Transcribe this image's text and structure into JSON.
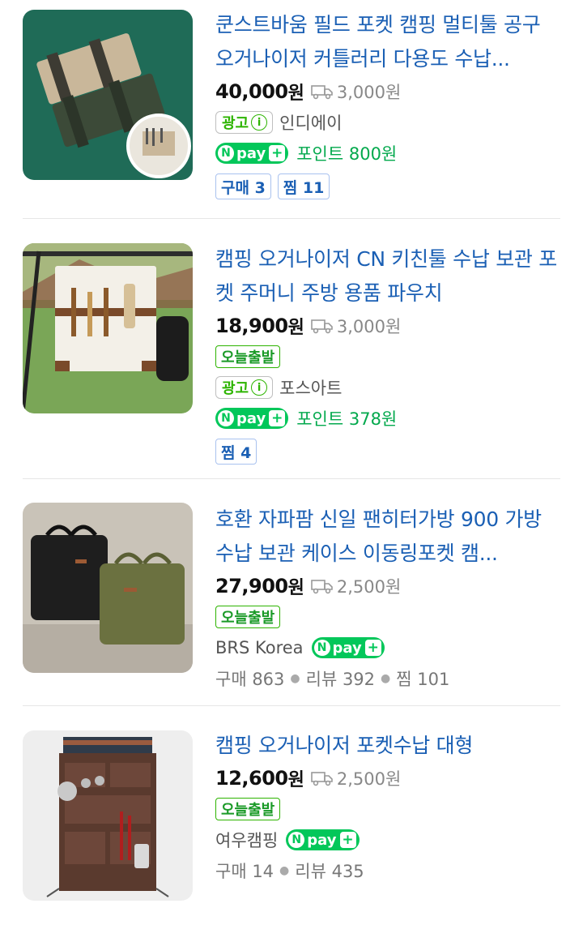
{
  "products": [
    {
      "title": "쿤스트바움 필드 포켓 캠핑 멀티툴 공구 오거나이저 커틀러리 다용도 수납...",
      "price": "40,000",
      "won": "원",
      "shipping": "3,000원",
      "ad_label": "광고",
      "ad_info": "i",
      "seller": "인디에이",
      "npay_text": "pay",
      "points": "포인트 800원",
      "badges": [
        "구매 3",
        "찜 11"
      ]
    },
    {
      "title": "캠핑 오거나이저 CN 키친툴 수납 보관 포켓 주머니 주방 용품 파우치",
      "price": "18,900",
      "won": "원",
      "shipping": "3,000원",
      "today_label": "오늘출발",
      "ad_label": "광고",
      "ad_info": "i",
      "seller": "포스아트",
      "npay_text": "pay",
      "points": "포인트 378원",
      "badges": [
        "찜 4"
      ]
    },
    {
      "title": "호환 자파팜 신일 팬히터가방 900 가방 수납 보관 케이스 이동링포켓 캠...",
      "price": "27,900",
      "won": "원",
      "shipping": "2,500원",
      "today_label": "오늘출발",
      "seller": "BRS Korea",
      "npay_text": "pay",
      "stats": [
        "구매 863",
        "리뷰 392",
        "찜 101"
      ]
    },
    {
      "title": "캠핑 오거나이저 포켓수납 대형",
      "price": "12,600",
      "won": "원",
      "shipping": "2,500원",
      "today_label": "오늘출발",
      "seller": "여우캠핑",
      "npay_text": "pay",
      "stats": [
        "구매 14",
        "리뷰 435"
      ]
    }
  ],
  "icons": {
    "shipping": "truck-icon",
    "npay_plus": "plus-icon",
    "ad_info": "info-icon"
  },
  "colors": {
    "title": "#1a5fb4",
    "npay": "#03c75a",
    "badge_green": "#2db400"
  }
}
